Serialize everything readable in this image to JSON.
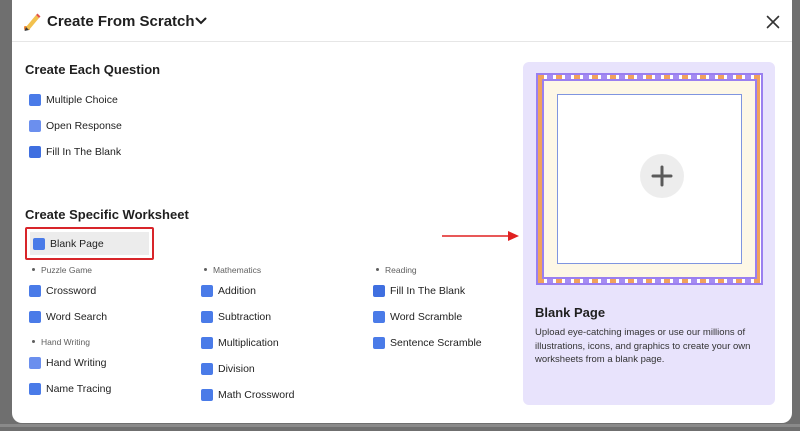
{
  "header": {
    "title": "Create From Scratch",
    "icons": {
      "app": "pencil-icon",
      "menu": "chevron-down-icon",
      "close": "close-icon"
    }
  },
  "create_each": {
    "title": "Create Each Question",
    "items": [
      {
        "label": "Multiple Choice",
        "icon": "multiple-choice-icon"
      },
      {
        "label": "Open Response",
        "icon": "open-response-icon"
      },
      {
        "label": "Fill In The Blank",
        "icon": "fill-blank-icon"
      }
    ]
  },
  "specific": {
    "title": "Create Specific Worksheet",
    "blank_page": {
      "label": "Blank Page",
      "icon": "blank-page-icon"
    },
    "puzzle": {
      "label": "Puzzle Game",
      "items": [
        {
          "label": "Crossword",
          "icon": "crossword-icon"
        },
        {
          "label": "Word Search",
          "icon": "word-search-icon"
        }
      ]
    },
    "hand_writing": {
      "label": "Hand Writing",
      "items": [
        {
          "label": "Hand Writing",
          "icon": "hand-writing-icon"
        },
        {
          "label": "Name Tracing",
          "icon": "name-tracing-icon"
        }
      ]
    },
    "math": {
      "label": "Mathematics",
      "items": [
        {
          "label": "Addition",
          "icon": "addition-icon"
        },
        {
          "label": "Subtraction",
          "icon": "subtraction-icon"
        },
        {
          "label": "Multiplication",
          "icon": "multiplication-icon"
        },
        {
          "label": "Division",
          "icon": "division-icon"
        },
        {
          "label": "Math Crossword",
          "icon": "math-crossword-icon"
        }
      ]
    },
    "reading": {
      "label": "Reading",
      "items": [
        {
          "label": "Fill In The Blank",
          "icon": "reading-fill-blank-icon"
        },
        {
          "label": "Word Scramble",
          "icon": "word-scramble-icon"
        },
        {
          "label": "Sentence Scramble",
          "icon": "sentence-scramble-icon"
        }
      ]
    }
  },
  "preview": {
    "title": "Blank Page",
    "description": "Upload eye-catching images or use our millions of illustrations, icons, and graphics to create your own worksheets from a blank page."
  },
  "colors": {
    "icon_blue": "#4a7be8",
    "highlight_red": "#d8252a",
    "preview_bg": "#e8e3fc",
    "frame_purple": "#9a7ff0",
    "frame_orange": "#f1a15c"
  }
}
